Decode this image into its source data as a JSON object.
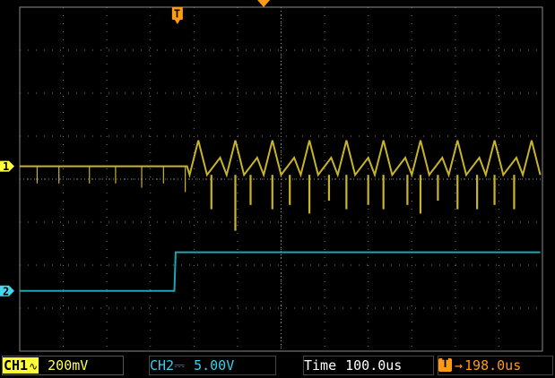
{
  "colors": {
    "background": "#000000",
    "grid": "#8a8a8a",
    "ch1": "#c8b428",
    "ch2": "#18a8b4",
    "trigger": "#ff9a18"
  },
  "channels": [
    {
      "id": "CH1",
      "marker": "1",
      "coupling_icon": "ac-coupling-icon",
      "scale": "200mV",
      "color": "#c8b428"
    },
    {
      "id": "CH2",
      "marker": "2",
      "coupling_icon": "dc-coupling-icon",
      "scale": "5.00V",
      "color": "#18a8b4"
    }
  ],
  "statusbar": {
    "ch1_label": "CH1",
    "ch1_coupling": "∿",
    "ch1_scale": "200mV",
    "ch2_label": "CH2",
    "ch2_coupling": "⎓",
    "ch2_scale": "5.00V",
    "time_label": "Time",
    "time_scale": "100.0us",
    "trigger_arrow": "→",
    "trigger_position": "198.0us"
  },
  "markers": {
    "ch1": "1",
    "ch2": "2",
    "trigger": "T"
  },
  "chart_data": {
    "type": "line",
    "grid": true,
    "divisions": {
      "x": 12,
      "y": 8
    },
    "series": [
      {
        "channel": "CH1",
        "units": "div",
        "points": [
          [
            0.0,
            4.3
          ],
          [
            3.84,
            4.3
          ],
          [
            3.9,
            4.1
          ],
          [
            4.1,
            4.9
          ],
          [
            4.3,
            4.1
          ],
          [
            4.6,
            4.5
          ],
          [
            4.75,
            4.1
          ],
          [
            4.95,
            4.9
          ],
          [
            5.15,
            4.1
          ],
          [
            5.45,
            4.5
          ],
          [
            5.6,
            4.1
          ],
          [
            5.8,
            4.9
          ],
          [
            6.0,
            4.1
          ],
          [
            6.3,
            4.5
          ],
          [
            6.45,
            4.1
          ],
          [
            6.65,
            4.9
          ],
          [
            6.85,
            4.1
          ],
          [
            7.15,
            4.5
          ],
          [
            7.3,
            4.1
          ],
          [
            7.5,
            4.9
          ],
          [
            7.7,
            4.1
          ],
          [
            8.0,
            4.5
          ],
          [
            8.15,
            4.1
          ],
          [
            8.35,
            4.9
          ],
          [
            8.55,
            4.1
          ],
          [
            8.85,
            4.5
          ],
          [
            9.0,
            4.1
          ],
          [
            9.2,
            4.9
          ],
          [
            9.4,
            4.1
          ],
          [
            9.7,
            4.5
          ],
          [
            9.85,
            4.1
          ],
          [
            10.05,
            4.9
          ],
          [
            10.25,
            4.1
          ],
          [
            10.55,
            4.5
          ],
          [
            10.7,
            4.1
          ],
          [
            10.9,
            4.9
          ],
          [
            11.1,
            4.1
          ],
          [
            11.4,
            4.5
          ],
          [
            11.55,
            4.1
          ],
          [
            11.75,
            4.9
          ],
          [
            11.95,
            4.1
          ]
        ],
        "spikes": [
          [
            0.4,
            3.9
          ],
          [
            0.9,
            3.9
          ],
          [
            1.6,
            3.9
          ],
          [
            2.2,
            3.9
          ],
          [
            2.8,
            3.8
          ],
          [
            3.3,
            3.9
          ],
          [
            3.8,
            3.7
          ],
          [
            4.4,
            3.3
          ],
          [
            4.95,
            2.8
          ],
          [
            5.3,
            3.4
          ],
          [
            5.8,
            3.3
          ],
          [
            6.2,
            3.4
          ],
          [
            6.65,
            3.2
          ],
          [
            7.1,
            3.5
          ],
          [
            7.5,
            3.3
          ],
          [
            8.0,
            3.4
          ],
          [
            8.35,
            3.3
          ],
          [
            8.9,
            3.4
          ],
          [
            9.2,
            3.2
          ],
          [
            9.6,
            3.5
          ],
          [
            10.05,
            3.3
          ],
          [
            10.5,
            3.3
          ],
          [
            10.9,
            3.4
          ],
          [
            11.35,
            3.3
          ]
        ]
      },
      {
        "channel": "CH2",
        "units": "div",
        "points": [
          [
            0.0,
            1.4
          ],
          [
            3.55,
            1.4
          ],
          [
            3.58,
            2.3
          ],
          [
            11.95,
            2.3
          ]
        ]
      }
    ],
    "trigger_mark_x_div": 3.62,
    "horizontal_position_x_div": 5.6
  }
}
